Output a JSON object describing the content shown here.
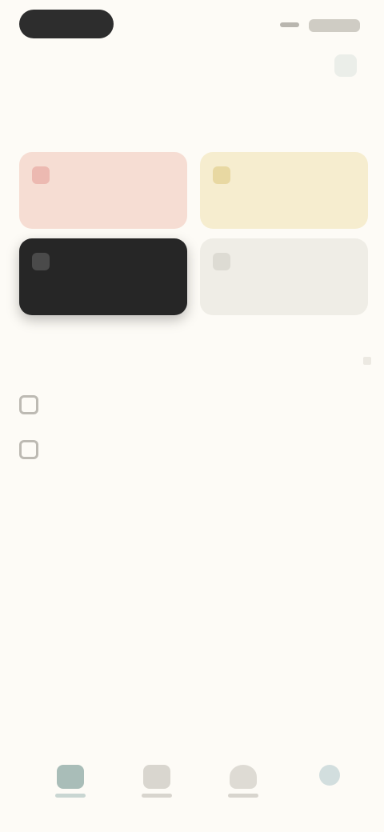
{
  "status_bar": {
    "time": "",
    "battery": ""
  },
  "section_title": "",
  "cards": [
    {
      "label": "",
      "color": "#f6ddd3"
    },
    {
      "label": "",
      "color": "#f6edcf"
    },
    {
      "label": "",
      "color": "#262626"
    },
    {
      "label": "",
      "color": "#efede6"
    }
  ],
  "list": {
    "heading": "",
    "items": [
      {
        "label": "",
        "icon": "checkbox-icon"
      },
      {
        "label": "",
        "icon": "gear-icon"
      }
    ]
  },
  "bottom_nav": [
    {
      "icon": "home-icon",
      "label": ""
    },
    {
      "icon": "list-icon",
      "label": ""
    },
    {
      "icon": "profile-icon",
      "label": ""
    },
    {
      "icon": "settings-icon",
      "label": ""
    }
  ],
  "colors": {
    "background": "#fdfbf6",
    "accent": "#a9bdb8",
    "dark_card": "#262626"
  }
}
